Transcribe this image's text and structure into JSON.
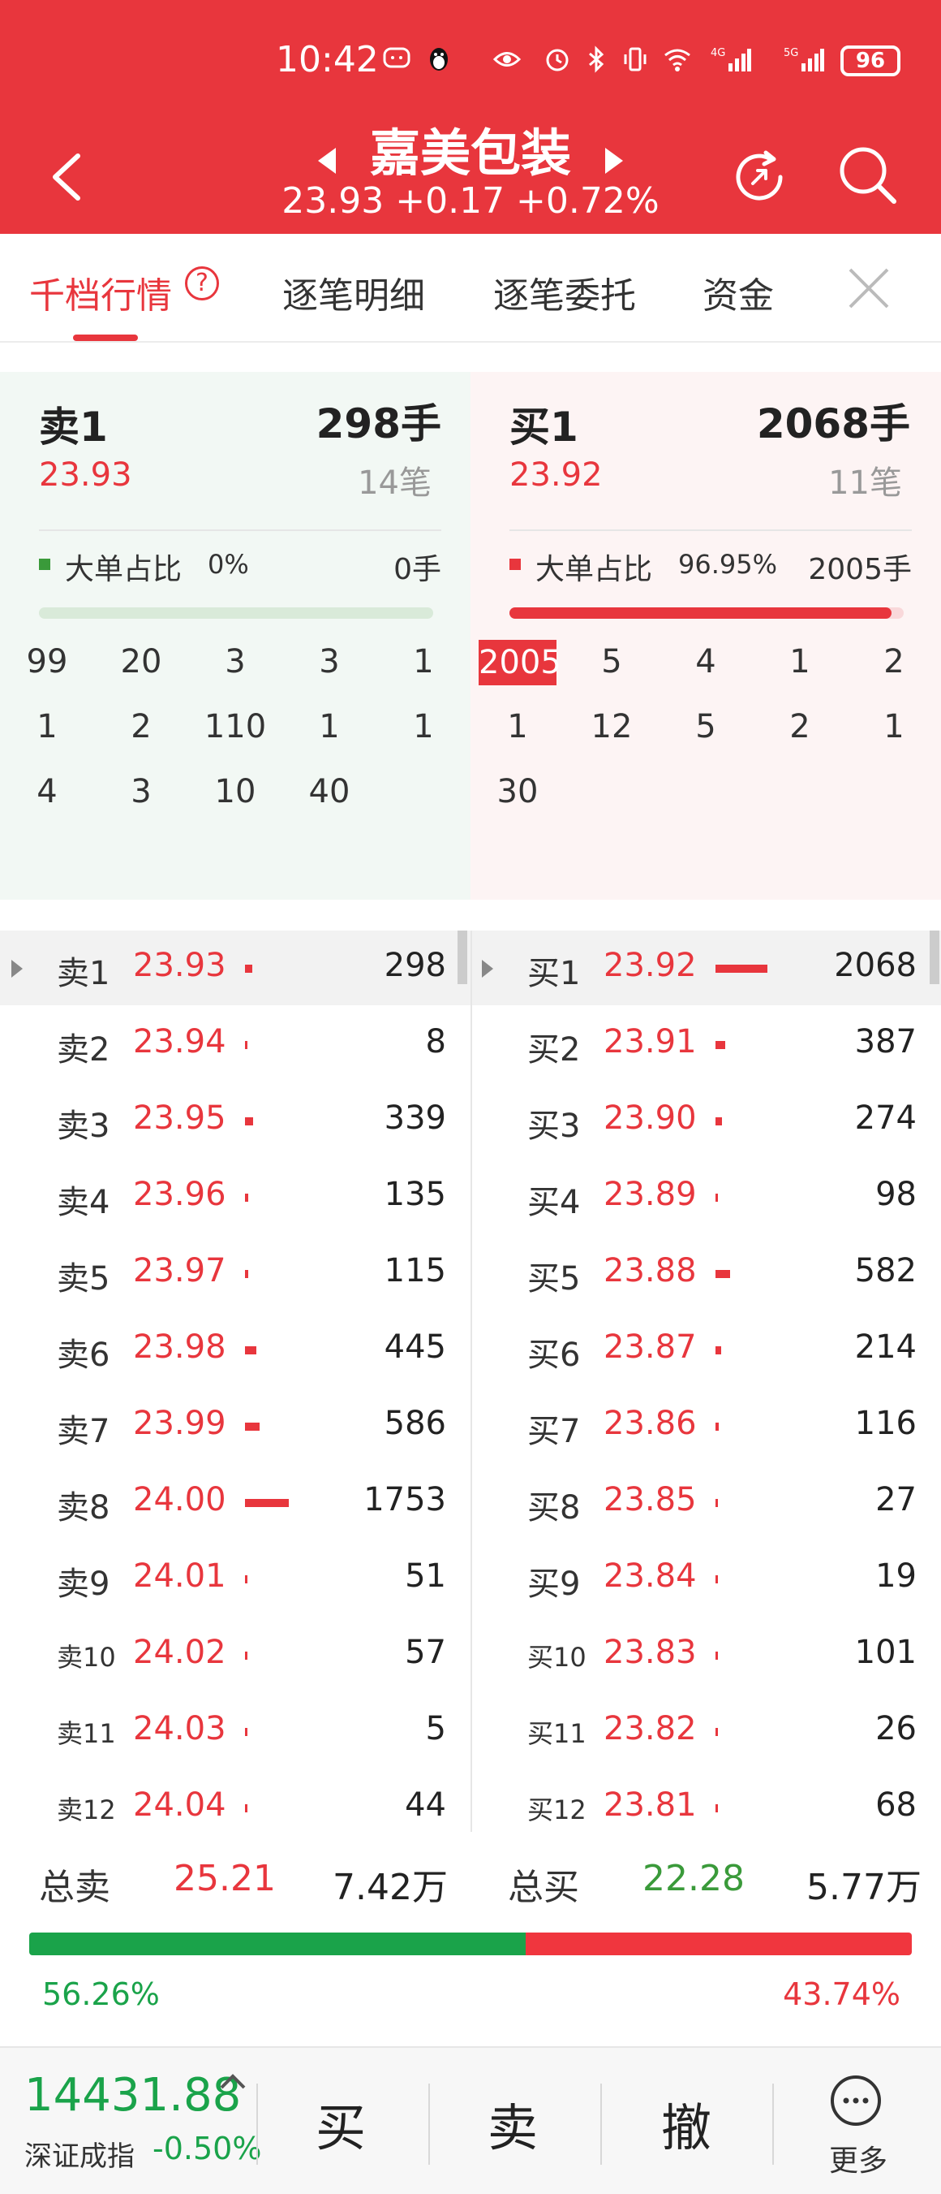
{
  "status_bar": {
    "time": "10:42",
    "battery": "96",
    "icons": [
      "chat-icon",
      "penguin-icon",
      "eye-icon",
      "alarm-icon",
      "bluetooth-icon",
      "vibrate-icon",
      "wifi-icon",
      "signal-4g-icon",
      "signal-5g-icon"
    ]
  },
  "header": {
    "stock_name": "嘉美包装",
    "quote": "23.93 +0.17 +0.72%"
  },
  "tabs": [
    {
      "label": "千档行情",
      "active": true
    },
    {
      "label": "逐笔明细",
      "active": false
    },
    {
      "label": "逐笔委托",
      "active": false
    },
    {
      "label": "资金",
      "active": false
    }
  ],
  "help_glyph": "?",
  "sell_panel": {
    "title": "卖1",
    "volume": "298手",
    "price": "23.93",
    "count": "14笔",
    "ratio_label": "大单占比",
    "ratio_value": "0%",
    "ratio_vol": "0手",
    "ratio_fraction": 0.0,
    "grid": [
      [
        "99",
        "20",
        "3",
        "3",
        "1"
      ],
      [
        "1",
        "2",
        "110",
        "1",
        "1"
      ],
      [
        "4",
        "3",
        "10",
        "40",
        ""
      ]
    ]
  },
  "buy_panel": {
    "title": "买1",
    "volume": "2068手",
    "price": "23.92",
    "count": "11笔",
    "ratio_label": "大单占比",
    "ratio_value": "96.95%",
    "ratio_vol": "2005手",
    "ratio_fraction": 0.9695,
    "grid": [
      [
        "2005",
        "5",
        "4",
        "1",
        "2"
      ],
      [
        "1",
        "12",
        "5",
        "2",
        "1"
      ],
      [
        "30",
        "",
        "",
        "",
        ""
      ]
    ]
  },
  "order_book": {
    "asks": [
      {
        "label": "卖1",
        "price": "23.93",
        "vol": "298",
        "bar": 298
      },
      {
        "label": "卖2",
        "price": "23.94",
        "vol": "8",
        "bar": 8
      },
      {
        "label": "卖3",
        "price": "23.95",
        "vol": "339",
        "bar": 339
      },
      {
        "label": "卖4",
        "price": "23.96",
        "vol": "135",
        "bar": 135
      },
      {
        "label": "卖5",
        "price": "23.97",
        "vol": "115",
        "bar": 115
      },
      {
        "label": "卖6",
        "price": "23.98",
        "vol": "445",
        "bar": 445
      },
      {
        "label": "卖7",
        "price": "23.99",
        "vol": "586",
        "bar": 586
      },
      {
        "label": "卖8",
        "price": "24.00",
        "vol": "1753",
        "bar": 1753
      },
      {
        "label": "卖9",
        "price": "24.01",
        "vol": "51",
        "bar": 51
      },
      {
        "label": "卖10",
        "price": "24.02",
        "vol": "57",
        "bar": 57
      },
      {
        "label": "卖11",
        "price": "24.03",
        "vol": "5",
        "bar": 5
      },
      {
        "label": "卖12",
        "price": "24.04",
        "vol": "44",
        "bar": 44
      }
    ],
    "bids": [
      {
        "label": "买1",
        "price": "23.92",
        "vol": "2068",
        "bar": 2068
      },
      {
        "label": "买2",
        "price": "23.91",
        "vol": "387",
        "bar": 387
      },
      {
        "label": "买3",
        "price": "23.90",
        "vol": "274",
        "bar": 274
      },
      {
        "label": "买4",
        "price": "23.89",
        "vol": "98",
        "bar": 98
      },
      {
        "label": "买5",
        "price": "23.88",
        "vol": "582",
        "bar": 582
      },
      {
        "label": "买6",
        "price": "23.87",
        "vol": "214",
        "bar": 214
      },
      {
        "label": "买7",
        "price": "23.86",
        "vol": "116",
        "bar": 116
      },
      {
        "label": "买8",
        "price": "23.85",
        "vol": "27",
        "bar": 27
      },
      {
        "label": "买9",
        "price": "23.84",
        "vol": "19",
        "bar": 19
      },
      {
        "label": "买10",
        "price": "23.83",
        "vol": "101",
        "bar": 101
      },
      {
        "label": "买11",
        "price": "23.82",
        "vol": "26",
        "bar": 26
      },
      {
        "label": "买12",
        "price": "23.81",
        "vol": "68",
        "bar": 68
      }
    ]
  },
  "totals": {
    "sell_label": "总卖",
    "sell_price": "25.21",
    "sell_amount": "7.42万",
    "buy_label": "总买",
    "buy_price": "22.28",
    "buy_amount": "5.77万",
    "sell_pct": "56.26%",
    "buy_pct": "43.74%",
    "sell_fraction": 0.5626
  },
  "bottom_bar": {
    "index_value": "14431.88",
    "index_name": "深证成指",
    "index_change": "-0.50%",
    "buy_label": "买",
    "sell_label": "卖",
    "cancel_label": "撤",
    "more_label": "更多"
  },
  "colors": {
    "header_red": "#e8363d",
    "price_red": "#e8363d",
    "green": "#1aa34a"
  }
}
